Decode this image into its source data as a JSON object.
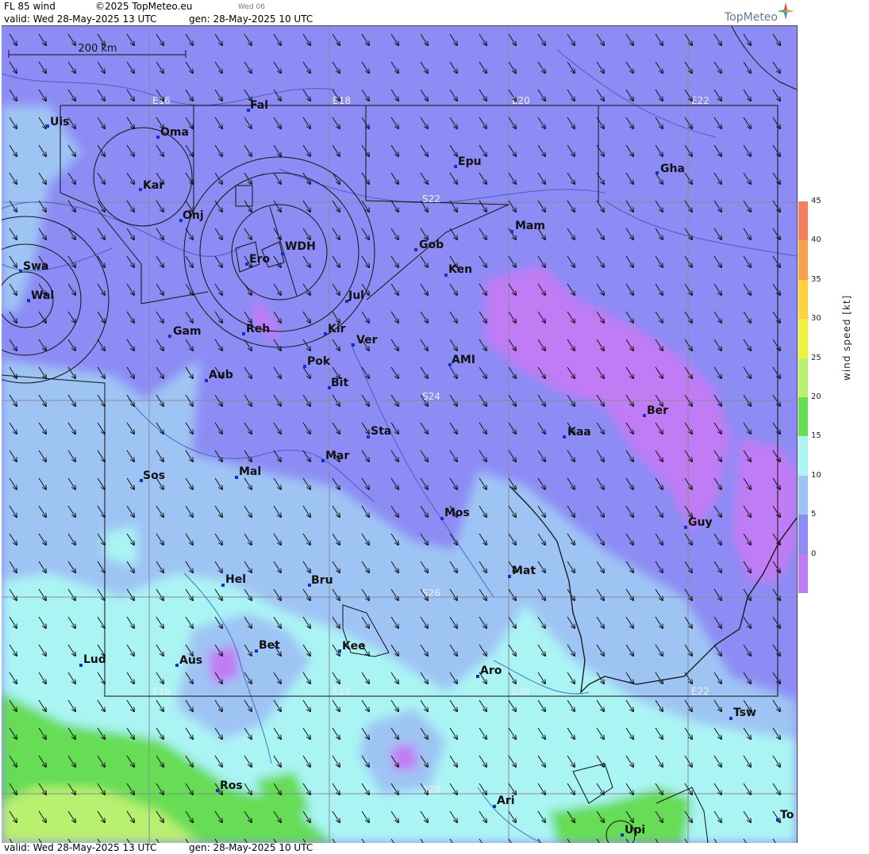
{
  "header": {
    "product": "FL 85 wind",
    "copyright": "©2025 TopMeteo.eu",
    "day_code": "Wed 06",
    "valid_line": "valid:  Wed  28-May-2025  13 UTC",
    "gen_line": "gen: 28-May-2025 10 UTC",
    "logo": "TopMeteo"
  },
  "footer": {
    "valid_line": "valid:  Wed  28-May-2025  13 UTC",
    "gen_line": "gen: 28-May-2025 10 UTC"
  },
  "map": {
    "scale_label": "200 km",
    "lon_labels": [
      "E16",
      "E18",
      "E20",
      "E22"
    ],
    "lat_labels": [
      "S22",
      "S24",
      "S26",
      "S28"
    ],
    "places": [
      "Uis",
      "Fal",
      "Oma",
      "Kar",
      "Onj",
      "Epu",
      "Gha",
      "Swa",
      "Wal",
      "Ero",
      "WDH",
      "Gob",
      "Mam",
      "Ken",
      "Jul",
      "Reh",
      "Kir",
      "Ver",
      "Gam",
      "Pok",
      "AMI",
      "Aub",
      "Bit",
      "Ber",
      "Sta",
      "Kaa",
      "Mar",
      "Sos",
      "Mal",
      "Mos",
      "Guy",
      "Mat",
      "Hel",
      "Bru",
      "Bet",
      "Kee",
      "Lud",
      "Aus",
      "Aro",
      "Tsw",
      "Ros",
      "Ari",
      "Upi",
      "To"
    ],
    "wind_direction": "from north-west (arrows point south-east)"
  },
  "legend": {
    "title": "wind speed [kt]",
    "ticks": [
      "45",
      "40",
      "35",
      "30",
      "25",
      "20",
      "15",
      "10",
      "5",
      "0"
    ],
    "colors": [
      "#f08060",
      "#f8a050",
      "#ffd040",
      "#eef040",
      "#b8f070",
      "#66dd55",
      "#aaf4f4",
      "#9ec4f4",
      "#8c8cf4",
      "#c07cf4"
    ]
  }
}
